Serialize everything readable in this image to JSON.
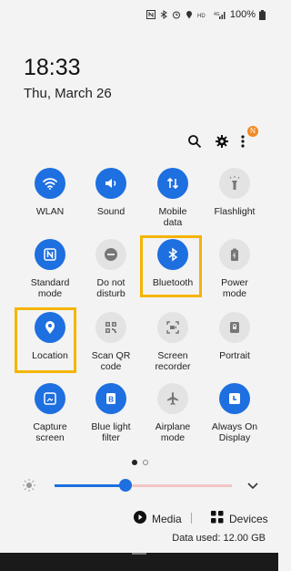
{
  "status_bar": {
    "battery": "100%"
  },
  "clock": {
    "time": "18:33",
    "date": "Thu, March 26"
  },
  "header": {
    "notification_badge": "N"
  },
  "tiles": [
    {
      "label": "WLAN",
      "icon": "wifi-icon",
      "on": true
    },
    {
      "label": "Sound",
      "icon": "sound-icon",
      "on": true
    },
    {
      "label": "Mobile\ndata",
      "icon": "mobile-data-icon",
      "on": true
    },
    {
      "label": "Flashlight",
      "icon": "flashlight-icon",
      "on": false
    },
    {
      "label": "Standard\nmode",
      "icon": "nfc-icon",
      "on": true
    },
    {
      "label": "Do not\ndisturb",
      "icon": "do-not-disturb-icon",
      "on": false
    },
    {
      "label": "Bluetooth",
      "icon": "bluetooth-icon",
      "on": true
    },
    {
      "label": "Power\nmode",
      "icon": "power-mode-icon",
      "on": false
    },
    {
      "label": "Location",
      "icon": "location-icon",
      "on": true
    },
    {
      "label": "Scan QR\ncode",
      "icon": "qr-code-icon",
      "on": false
    },
    {
      "label": "Screen\nrecorder",
      "icon": "screen-recorder-icon",
      "on": false
    },
    {
      "label": "Portrait",
      "icon": "portrait-lock-icon",
      "on": false
    },
    {
      "label": "Capture\nscreen",
      "icon": "capture-screen-icon",
      "on": true
    },
    {
      "label": "Blue light\nfilter",
      "icon": "blue-light-icon",
      "on": true
    },
    {
      "label": "Airplane\nmode",
      "icon": "airplane-icon",
      "on": false
    },
    {
      "label": "Always On\nDisplay",
      "icon": "always-on-display-icon",
      "on": true
    }
  ],
  "pagination": {
    "current": 1,
    "total": 2
  },
  "brightness": {
    "level": 0.4
  },
  "media": {
    "media_label": "Media",
    "devices_label": "Devices"
  },
  "data_usage": {
    "text": "Data used: 12.00 GB"
  },
  "colors": {
    "accent": "#1e6fe0",
    "highlight": "#f5b400"
  }
}
